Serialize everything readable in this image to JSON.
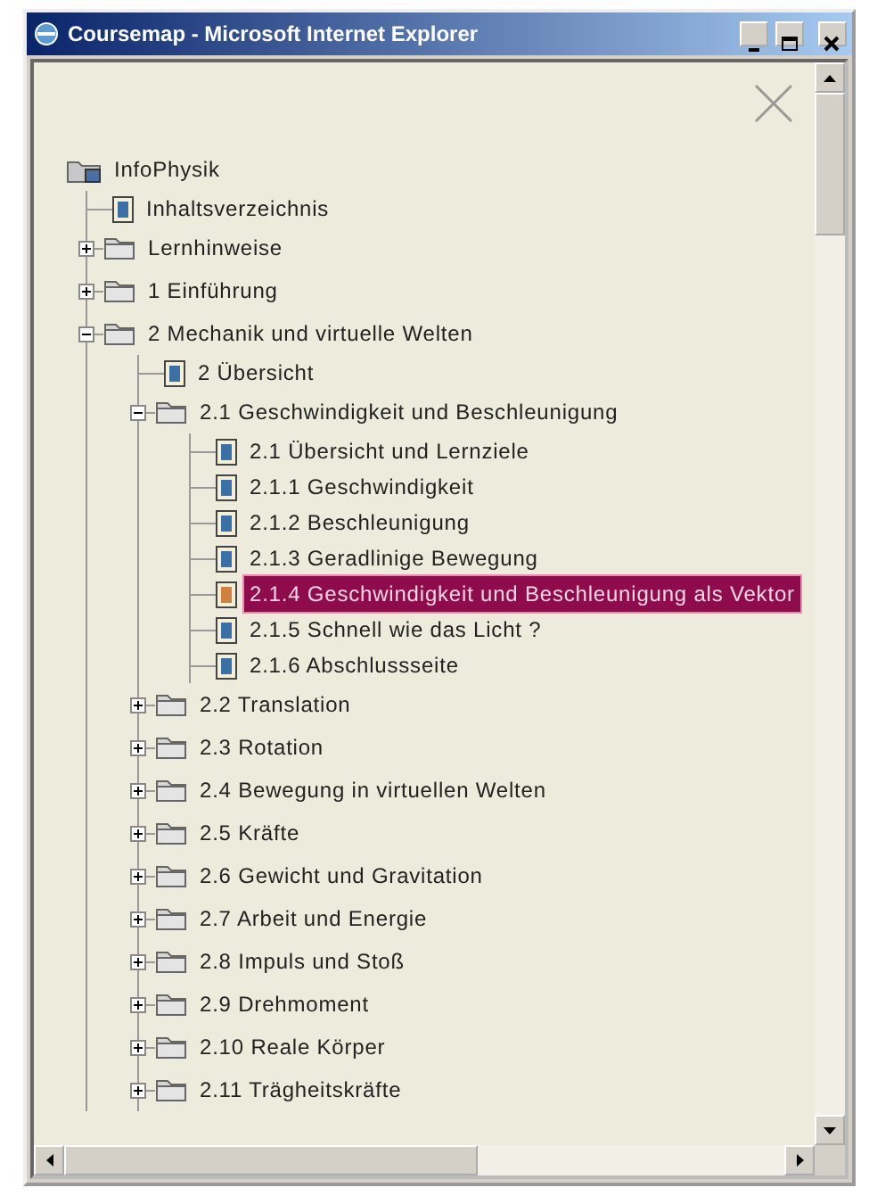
{
  "window": {
    "title": "Coursemap - Microsoft Internet Explorer"
  },
  "tree": {
    "label": "InfoPhysik",
    "kind": "root",
    "selected": false,
    "children": [
      {
        "label": "Inhaltsverzeichnis",
        "kind": "page",
        "selected": false
      },
      {
        "label": "Lernhinweise",
        "kind": "folder",
        "selected": false,
        "expanded": false
      },
      {
        "label": "1 Einführung",
        "kind": "folder",
        "selected": false,
        "expanded": false
      },
      {
        "label": "2 Mechanik und virtuelle Welten",
        "kind": "folder",
        "selected": false,
        "expanded": true,
        "children": [
          {
            "label": "2 Übersicht",
            "kind": "page",
            "selected": false
          },
          {
            "label": "2.1 Geschwindigkeit und Beschleunigung",
            "kind": "folder",
            "selected": false,
            "expanded": true,
            "children": [
              {
                "label": "2.1 Übersicht und Lernziele",
                "kind": "page",
                "selected": false
              },
              {
                "label": "2.1.1 Geschwindigkeit",
                "kind": "page",
                "selected": false
              },
              {
                "label": "2.1.2 Beschleunigung",
                "kind": "page",
                "selected": false
              },
              {
                "label": "2.1.3 Geradlinige Bewegung",
                "kind": "page",
                "selected": false
              },
              {
                "label": "2.1.4 Geschwindigkeit und Beschleunigung als Vektor",
                "kind": "page",
                "selected": true
              },
              {
                "label": "2.1.5 Schnell wie das Licht ?",
                "kind": "page",
                "selected": false
              },
              {
                "label": "2.1.6 Abschlussseite",
                "kind": "page",
                "selected": false
              }
            ]
          },
          {
            "label": "2.2 Translation",
            "kind": "folder",
            "selected": false,
            "expanded": false
          },
          {
            "label": "2.3 Rotation",
            "kind": "folder",
            "selected": false,
            "expanded": false
          },
          {
            "label": "2.4 Bewegung in virtuellen Welten",
            "kind": "folder",
            "selected": false,
            "expanded": false
          },
          {
            "label": "2.5 Kräfte",
            "kind": "folder",
            "selected": false,
            "expanded": false
          },
          {
            "label": "2.6 Gewicht und Gravitation",
            "kind": "folder",
            "selected": false,
            "expanded": false
          },
          {
            "label": "2.7 Arbeit und Energie",
            "kind": "folder",
            "selected": false,
            "expanded": false
          },
          {
            "label": "2.8 Impuls und Stoß",
            "kind": "folder",
            "selected": false,
            "expanded": false
          },
          {
            "label": "2.9 Drehmoment",
            "kind": "folder",
            "selected": false,
            "expanded": false
          },
          {
            "label": "2.10 Reale Körper",
            "kind": "folder",
            "selected": false,
            "expanded": false
          },
          {
            "label": "2.11 Trägheitskräfte",
            "kind": "folder",
            "selected": false,
            "expanded": false
          }
        ]
      }
    ]
  }
}
